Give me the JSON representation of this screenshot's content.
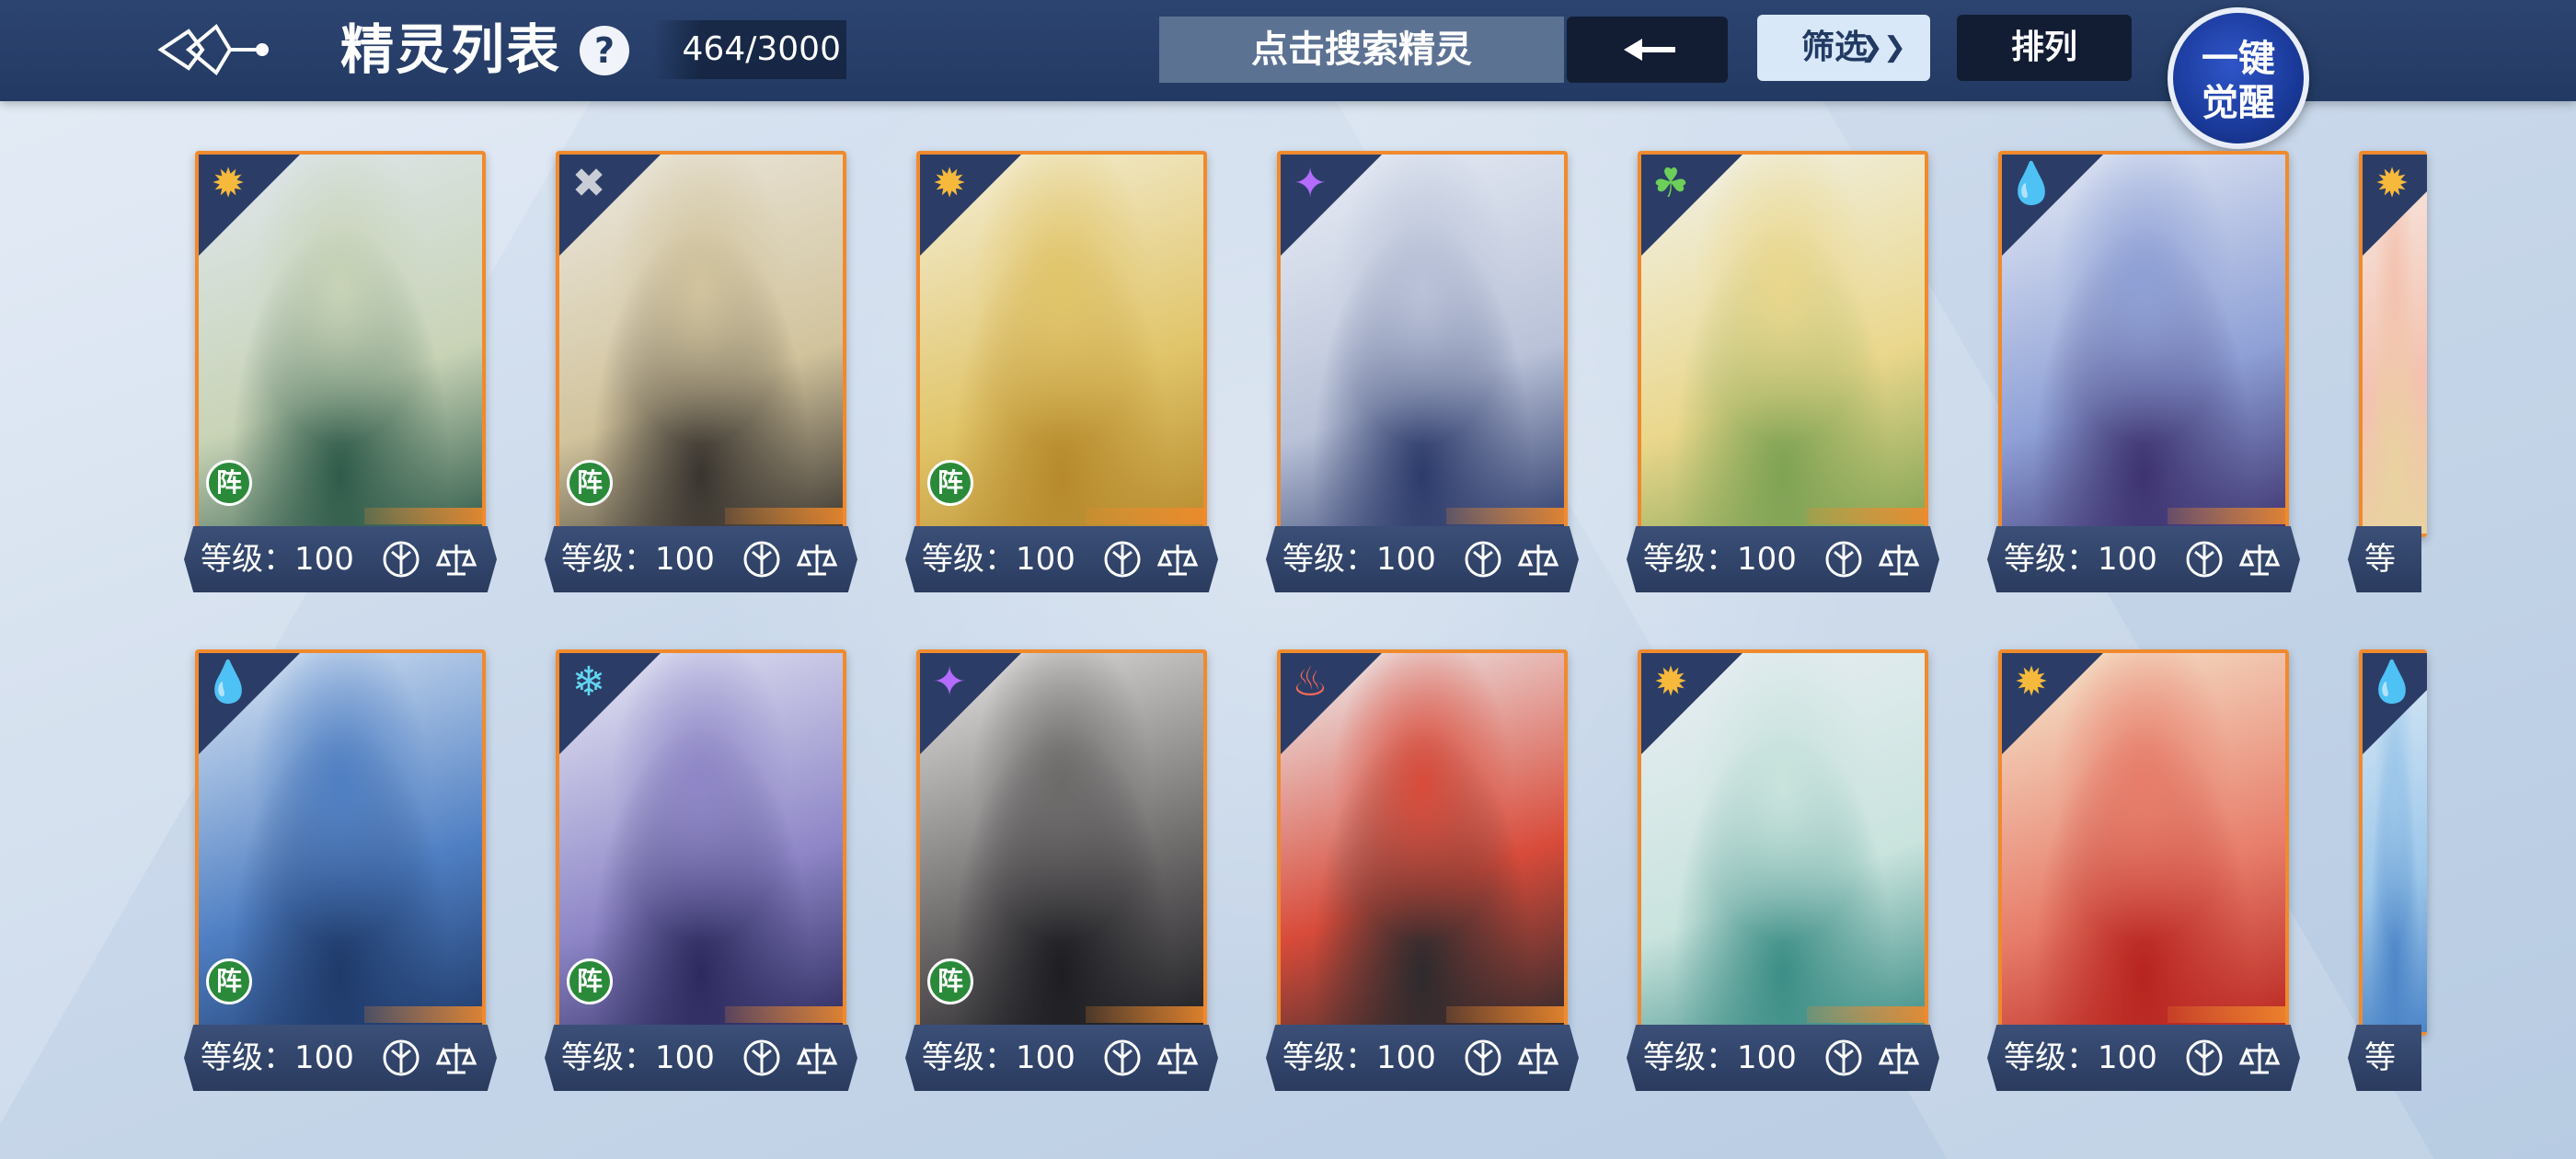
{
  "header": {
    "title": "精灵列表",
    "help": "?",
    "count": "464/3000",
    "search_placeholder": "点击搜索精灵",
    "filter_label": "筛选",
    "sort_label": "排列",
    "awaken_line1": "一键",
    "awaken_line2": "觉醒"
  },
  "cards": [
    {
      "level": "等级：100",
      "formation": "阵",
      "element": "light",
      "colors": [
        "#dfe7ee",
        "#c8d3b6",
        "#2f5b4a"
      ]
    },
    {
      "level": "等级：100",
      "formation": "阵",
      "element": "neutral",
      "colors": [
        "#ece8df",
        "#d1c39c",
        "#3a3530"
      ]
    },
    {
      "level": "等级：100",
      "formation": "阵",
      "element": "light",
      "colors": [
        "#f4efd8",
        "#e1c56a",
        "#b68a2c"
      ]
    },
    {
      "level": "等级：100",
      "formation": "",
      "element": "shadow",
      "colors": [
        "#e9eef6",
        "#b9c2d8",
        "#2d3b6b"
      ]
    },
    {
      "level": "等级：100",
      "formation": "",
      "element": "grass",
      "colors": [
        "#f1f2ea",
        "#ead78c",
        "#7ea253"
      ]
    },
    {
      "level": "等级：100",
      "formation": "",
      "element": "water",
      "colors": [
        "#e5ebf5",
        "#8ea0d6",
        "#3d3370"
      ]
    },
    {
      "level": "等级",
      "formation": "",
      "element": "light",
      "colors": [
        "#f7e8e2",
        "#f3c2b0",
        "#e9d2a0"
      ]
    },
    {
      "level": "等级：100",
      "formation": "阵",
      "element": "water",
      "colors": [
        "#d9e6f5",
        "#4f7fc3",
        "#1f3a6a"
      ]
    },
    {
      "level": "等级：100",
      "formation": "阵",
      "element": "ice",
      "colors": [
        "#e5e8f5",
        "#8e86c7",
        "#2c2a5e"
      ]
    },
    {
      "level": "等级：100",
      "formation": "阵",
      "element": "shadow",
      "colors": [
        "#e6e4e3",
        "#6d6a6a",
        "#1d1d22"
      ]
    },
    {
      "level": "等级：100",
      "formation": "",
      "element": "fire",
      "colors": [
        "#eef0f2",
        "#d84b3a",
        "#2d2a2d"
      ]
    },
    {
      "level": "等级：100",
      "formation": "",
      "element": "light",
      "colors": [
        "#e9eef4",
        "#c9e3dd",
        "#3c8e86"
      ]
    },
    {
      "level": "等级：100",
      "formation": "",
      "element": "light",
      "colors": [
        "#f6e8cf",
        "#e77d6a",
        "#b8241f"
      ]
    },
    {
      "level": "等级",
      "formation": "",
      "element": "water",
      "colors": [
        "#dbe9f6",
        "#9cc7ea",
        "#4d86c8"
      ]
    }
  ],
  "icon_names": [
    "help-icon",
    "back-arrow-icon",
    "chevron-down-icon",
    "element-light-icon",
    "element-water-icon",
    "element-grass-icon",
    "element-fire-icon",
    "element-shadow-icon",
    "element-ice-icon",
    "element-neutral-icon"
  ]
}
